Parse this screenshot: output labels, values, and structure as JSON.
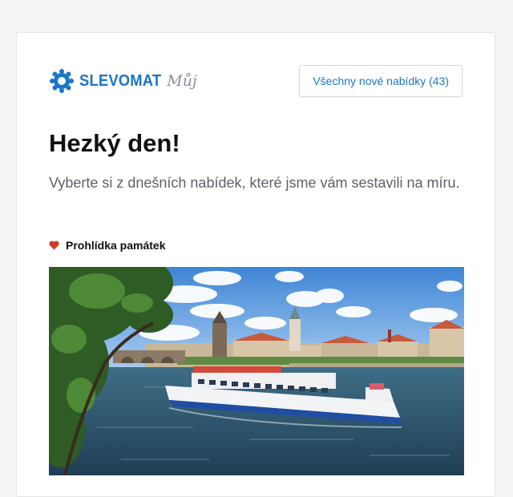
{
  "header": {
    "brand": "SLEVOMAT",
    "brand_suffix": "Můj",
    "all_offers_label": "Všechny nové nabídky (43)"
  },
  "main": {
    "greeting": "Hezký den!",
    "subtitle": "Vyberte si z dnešních nabídek, které jsme vám sestavili na míru.",
    "category": {
      "icon": "heart-icon",
      "label": "Prohlídka památek"
    }
  },
  "colors": {
    "brand": "#1b76c8",
    "heart": "#d23b2a"
  }
}
